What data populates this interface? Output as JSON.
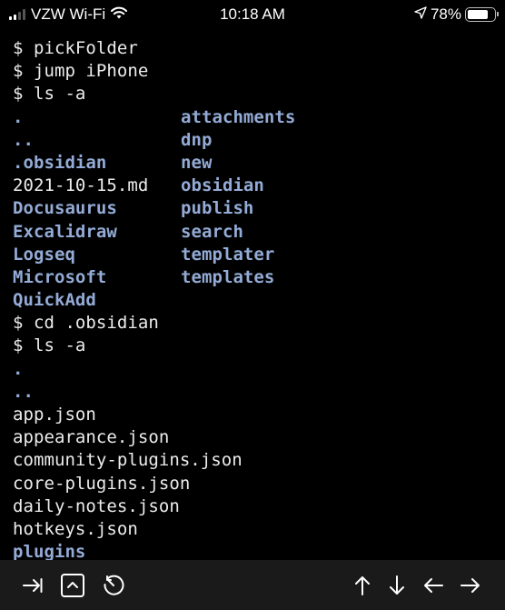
{
  "status_bar": {
    "carrier": "VZW Wi-Fi",
    "time": "10:18 AM",
    "battery": "78%",
    "battery_level": 0.78,
    "icons": [
      "signal-icon",
      "wifi-icon",
      "location-arrow-icon",
      "battery-icon"
    ]
  },
  "terminal": {
    "colors": {
      "directory": "#93abd6",
      "file": "#ececec",
      "background": "#000000"
    },
    "commands_1": [
      "$ pickFolder",
      "$ jump iPhone",
      "$ ls -a"
    ],
    "listing_1": {
      "left": [
        {
          "name": ".",
          "type": "dir"
        },
        {
          "name": "..",
          "type": "dir"
        },
        {
          "name": ".obsidian",
          "type": "dir"
        },
        {
          "name": "2021-10-15.md",
          "type": "file"
        },
        {
          "name": "Docusaurus",
          "type": "dir"
        },
        {
          "name": "Excalidraw",
          "type": "dir"
        },
        {
          "name": "Logseq",
          "type": "dir"
        },
        {
          "name": "Microsoft",
          "type": "dir"
        },
        {
          "name": "QuickAdd",
          "type": "dir"
        }
      ],
      "right": [
        {
          "name": "attachments",
          "type": "dir"
        },
        {
          "name": "dnp",
          "type": "dir"
        },
        {
          "name": "new",
          "type": "dir"
        },
        {
          "name": "obsidian",
          "type": "dir"
        },
        {
          "name": "publish",
          "type": "dir"
        },
        {
          "name": "search",
          "type": "dir"
        },
        {
          "name": "templater",
          "type": "dir"
        },
        {
          "name": "templates",
          "type": "dir"
        }
      ]
    },
    "commands_2": [
      "$ cd .obsidian",
      "$ ls -a"
    ],
    "listing_2": [
      {
        "name": ".",
        "type": "dir"
      },
      {
        "name": "..",
        "type": "dir"
      },
      {
        "name": "app.json",
        "type": "file"
      },
      {
        "name": "appearance.json",
        "type": "file"
      },
      {
        "name": "community-plugins.json",
        "type": "file"
      },
      {
        "name": "core-plugins.json",
        "type": "file"
      },
      {
        "name": "daily-notes.json",
        "type": "file"
      },
      {
        "name": "hotkeys.json",
        "type": "file"
      },
      {
        "name": "plugins",
        "type": "dir"
      }
    ]
  },
  "toolbar": {
    "left_buttons": [
      "tab-key-icon",
      "control-key-icon",
      "history-icon"
    ],
    "right_buttons": [
      "arrow-up-icon",
      "arrow-down-icon",
      "arrow-left-icon",
      "arrow-right-icon"
    ]
  }
}
